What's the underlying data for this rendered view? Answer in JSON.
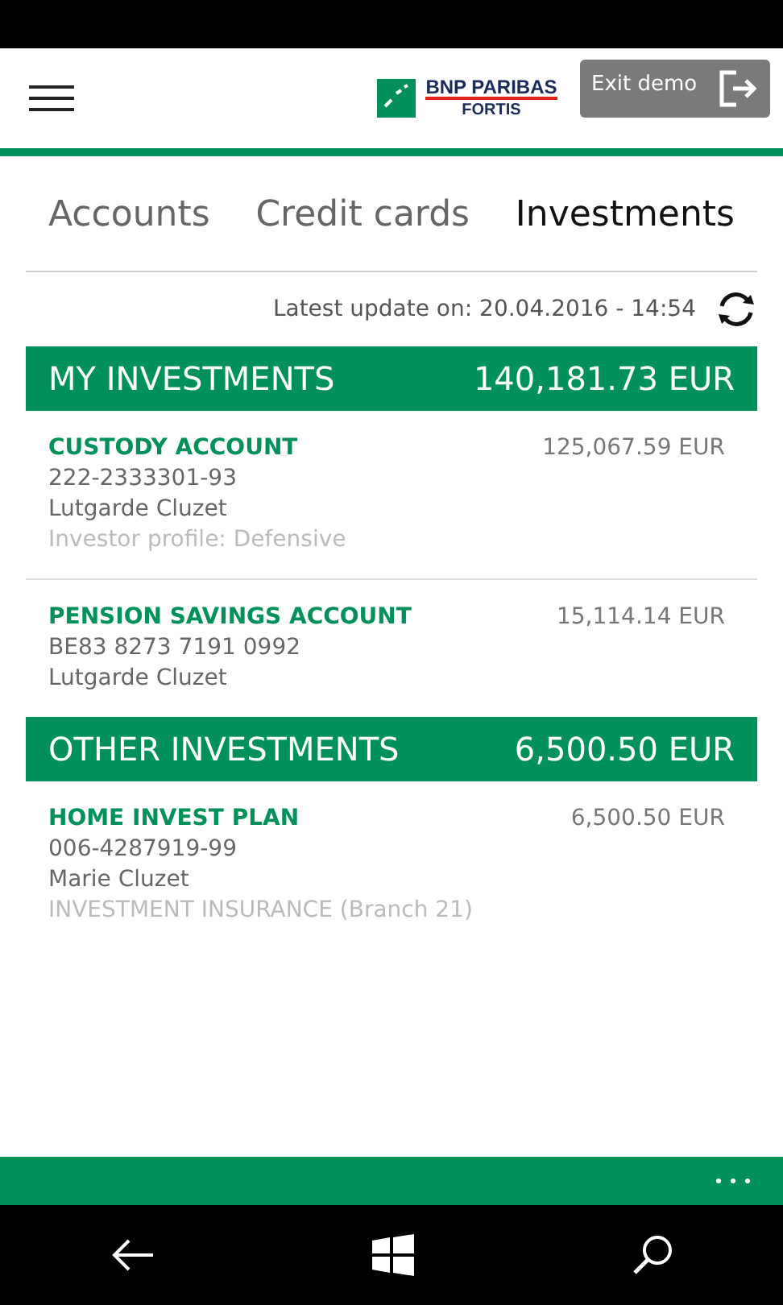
{
  "header": {
    "logo_line_1": "BNP PARIBAS",
    "logo_line_2": "FORTIS",
    "exit_button": "Exit demo"
  },
  "tabs": [
    {
      "label": "Accounts",
      "selected": false
    },
    {
      "label": "Credit cards",
      "selected": false
    },
    {
      "label": "Investments",
      "selected": true
    }
  ],
  "latest_update": "Latest update on: 20.04.2016 - 14:54",
  "sections": [
    {
      "title": "MY INVESTMENTS",
      "total": "140,181.73 EUR",
      "items": [
        {
          "name": "CUSTODY ACCOUNT",
          "amount": "125,067.59 EUR",
          "number": "222-2333301-93",
          "holder": "Lutgarde Cluzet",
          "note": "Investor profile:  Defensive"
        },
        {
          "name": "PENSION SAVINGS ACCOUNT",
          "amount": "15,114.14 EUR",
          "number": "BE83 8273 7191 0992",
          "holder": "Lutgarde Cluzet"
        }
      ]
    },
    {
      "title": "OTHER INVESTMENTS",
      "total": "6,500.50 EUR",
      "items": [
        {
          "name": "HOME INVEST PLAN",
          "amount": "6,500.50 EUR",
          "number": "006-4287919-99",
          "holder": "Marie Cluzet",
          "note": "INVESTMENT INSURANCE  (Branch 21)"
        }
      ]
    }
  ]
}
